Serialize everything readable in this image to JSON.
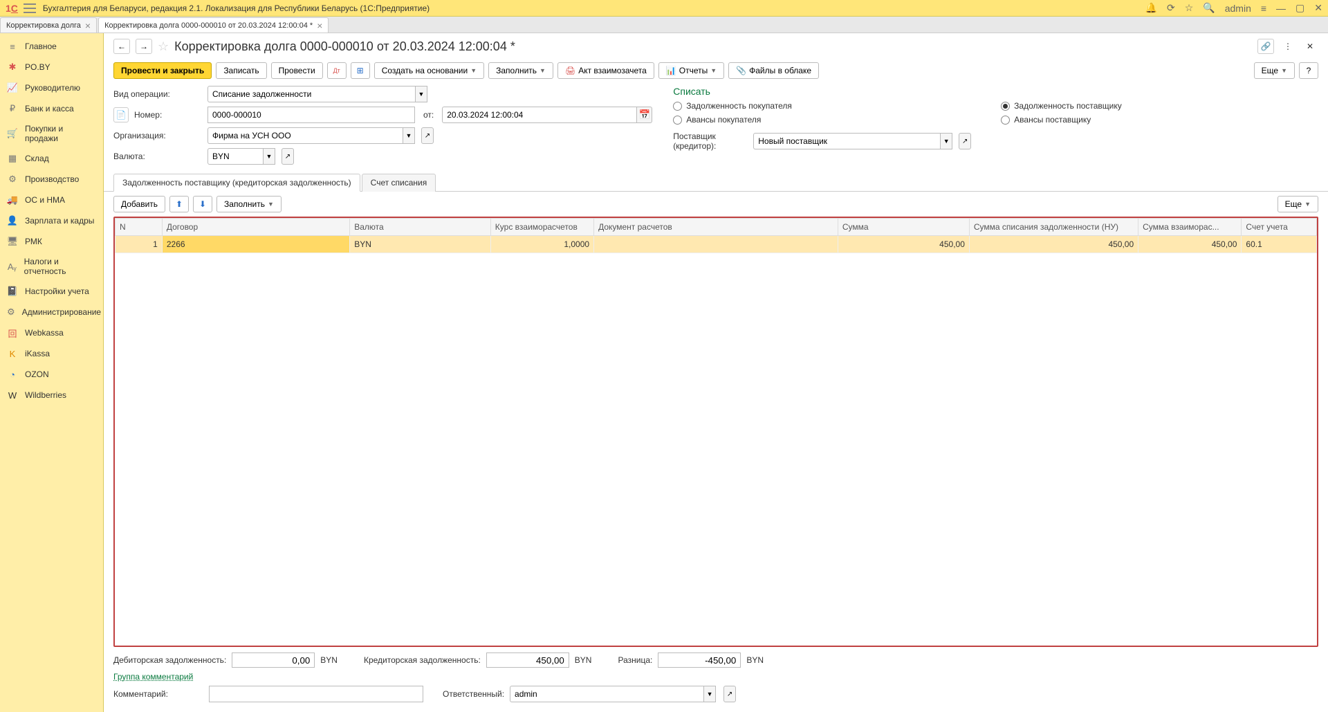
{
  "app_title": "Бухгалтерия для Беларуси, редакция 2.1. Локализация для Республики Беларусь   (1С:Предприятие)",
  "user": "admin",
  "tabs": [
    {
      "label": "Корректировка долга",
      "active": false
    },
    {
      "label": "Корректировка долга 0000-000010 от 20.03.2024 12:00:04 *",
      "active": true
    }
  ],
  "sidebar": [
    {
      "label": "Главное",
      "icon": "≡",
      "cls": "icon-gray"
    },
    {
      "label": "PO.BY",
      "icon": "✱",
      "cls": "icon-red"
    },
    {
      "label": "Руководителю",
      "icon": "📈",
      "cls": "icon-gray"
    },
    {
      "label": "Банк и касса",
      "icon": "₽",
      "cls": "icon-gray"
    },
    {
      "label": "Покупки и продажи",
      "icon": "🛒",
      "cls": "icon-gray"
    },
    {
      "label": "Склад",
      "icon": "▦",
      "cls": "icon-gray"
    },
    {
      "label": "Производство",
      "icon": "⚙",
      "cls": "icon-gray"
    },
    {
      "label": "ОС и НМА",
      "icon": "🚚",
      "cls": "icon-gray"
    },
    {
      "label": "Зарплата и кадры",
      "icon": "👤",
      "cls": "icon-gray"
    },
    {
      "label": "РМК",
      "icon": "🖥",
      "cls": "icon-gray"
    },
    {
      "label": "Налоги и отчетность",
      "icon": "Aᵧ",
      "cls": "icon-gray"
    },
    {
      "label": "Настройки учета",
      "icon": "📓",
      "cls": "icon-gray"
    },
    {
      "label": "Администрирование",
      "icon": "⚙",
      "cls": "icon-gray"
    },
    {
      "label": "Webkassa",
      "icon": "回",
      "cls": "icon-red"
    },
    {
      "label": "iKassa",
      "icon": "K",
      "cls": "icon-orange"
    },
    {
      "label": "OZON",
      "icon": "◔",
      "cls": "icon-blue"
    },
    {
      "label": "Wildberries",
      "icon": "W",
      "cls": ""
    }
  ],
  "doc": {
    "title": "Корректировка долга 0000-000010 от 20.03.2024 12:00:04 *",
    "buttons": {
      "post_close": "Провести и закрыть",
      "save": "Записать",
      "post": "Провести",
      "create_from": "Создать на основании",
      "fill": "Заполнить",
      "act": "Акт взаимозачета",
      "reports": "Отчеты",
      "files": "Файлы в облаке",
      "more": "Еще"
    },
    "fields": {
      "op_label": "Вид операции:",
      "op_value": "Списание задолженности",
      "num_label": "Номер:",
      "num_value": "0000-000010",
      "from_label": "от:",
      "date_value": "20.03.2024 12:00:04",
      "org_label": "Организация:",
      "org_value": "Фирма на УСН ООО",
      "cur_label": "Валюта:",
      "cur_value": "BYN"
    },
    "right": {
      "title": "Списать",
      "r1": "Задолженность покупателя",
      "r2": "Задолженность поставщику",
      "r3": "Авансы покупателя",
      "r4": "Авансы поставщику",
      "sup_label": "Поставщик (кредитор):",
      "sup_value": "Новый поставщик"
    },
    "doc_tabs": {
      "t1": "Задолженность поставщику (кредиторская задолженность)",
      "t2": "Счет списания"
    },
    "table_toolbar": {
      "add": "Добавить",
      "fill": "Заполнить",
      "more": "Еще"
    },
    "columns": {
      "n": "N",
      "contract": "Договор",
      "currency": "Валюта",
      "rate": "Курс взаиморасчетов",
      "doc": "Документ расчетов",
      "sum": "Сумма",
      "sum_nu": "Сумма списания задолженности (НУ)",
      "sum_mr": "Сумма взаиморас...",
      "acct": "Счет учета"
    },
    "rows": [
      {
        "n": "1",
        "contract": "2266",
        "currency": "BYN",
        "rate": "1,0000",
        "doc": "",
        "sum": "450,00",
        "sum_nu": "450,00",
        "sum_mr": "450,00",
        "acct": "60.1"
      }
    ],
    "footer": {
      "deb_label": "Дебиторская задолженность:",
      "deb_val": "0,00",
      "deb_cur": "BYN",
      "cred_label": "Кредиторская задолженность:",
      "cred_val": "450,00",
      "cred_cur": "BYN",
      "diff_label": "Разница:",
      "diff_val": "-450,00",
      "diff_cur": "BYN",
      "group_link": "Группа комментарий",
      "comment_label": "Комментарий:",
      "resp_label": "Ответственный:",
      "resp_val": "admin"
    }
  }
}
